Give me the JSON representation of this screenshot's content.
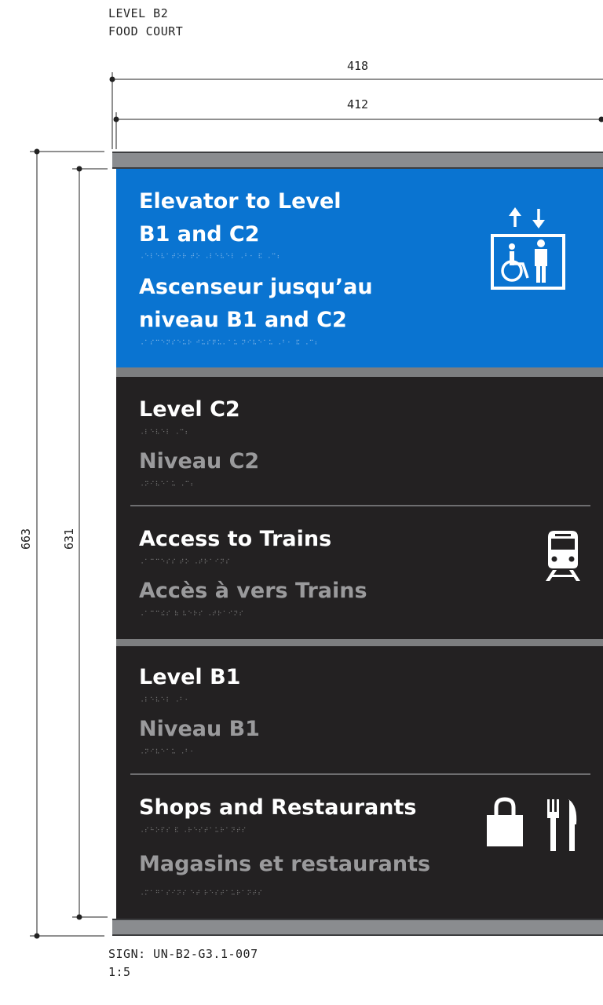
{
  "header": {
    "line1": "LEVEL B2",
    "line2": "FOOD COURT"
  },
  "dimensions": {
    "outer_width": "418",
    "inner_width": "412",
    "outer_height": "663",
    "inner_height": "631"
  },
  "sections": [
    {
      "id": "elevator",
      "title_en_1": "Elevator to Level",
      "title_en_2": "B1 and C2",
      "braille_en": "⠠⠑⠇⠑⠧⠁⠞⠕⠗ ⠞⠕ ⠠⠇⠑⠧⠑⠇ ⠠⠃⠂ ⠯ ⠠⠉⠆",
      "title_fr_1": "Ascenseur jusqu’au",
      "title_fr_2": "niveau B1 and C2",
      "braille_fr": "⠠⠁⠎⠉⠑⠝⠎⠑⠥⠗ ⠚⠥⠎⠟⠥⠄⠁⠥ ⠝⠊⠧⠑⠁⠥ ⠠⠃⠂ ⠯ ⠠⠉⠆",
      "icon": "elevator-accessible-icon"
    },
    {
      "id": "level-c2",
      "title_en": "Level C2",
      "braille_en": "⠠⠇⠑⠧⠑⠇ ⠠⠉⠆",
      "title_fr": "Niveau C2",
      "braille_fr": "⠠⠝⠊⠧⠑⠁⠥ ⠠⠉⠆"
    },
    {
      "id": "trains",
      "title_en": "Access to Trains",
      "braille_en": "⠠⠁⠉⠉⠑⠎⠎ ⠞⠕ ⠠⠞⠗⠁⠊⠝⠎",
      "title_fr": "Accès à vers Trains",
      "braille_fr": "⠠⠁⠉⠉⠮⠎ ⠷ ⠧⠑⠗⠎ ⠠⠞⠗⠁⠊⠝⠎",
      "icon": "train-icon"
    },
    {
      "id": "level-b1",
      "title_en": "Level B1",
      "braille_en": "⠠⠇⠑⠧⠑⠇ ⠠⠃⠂",
      "title_fr": "Niveau B1",
      "braille_fr": "⠠⠝⠊⠧⠑⠁⠥ ⠠⠃⠂"
    },
    {
      "id": "shops",
      "title_en": "Shops and Restaurants",
      "braille_en": "⠠⠎⠓⠕⠏⠎ ⠯ ⠠⠗⠑⠎⠞⠁⠥⠗⠁⠝⠞⠎",
      "title_fr": "Magasins et restaurants",
      "braille_fr": "⠠⠍⠁⠛⠁⠎⠊⠝⠎ ⠑⠞ ⠗⠑⠎⠞⠁⠥⠗⠁⠝⠞⠎",
      "icons": [
        "shopping-bag-icon",
        "fork-knife-icon"
      ]
    }
  ],
  "footer": {
    "sign_id": "SIGN: UN-B2-G3.1-007",
    "scale": "1:5"
  },
  "colors": {
    "blue_panel": "#0a74d1",
    "dark_panel": "#232122",
    "frame": "#8a8c8f",
    "secondary_text": "#9a9a9c"
  }
}
